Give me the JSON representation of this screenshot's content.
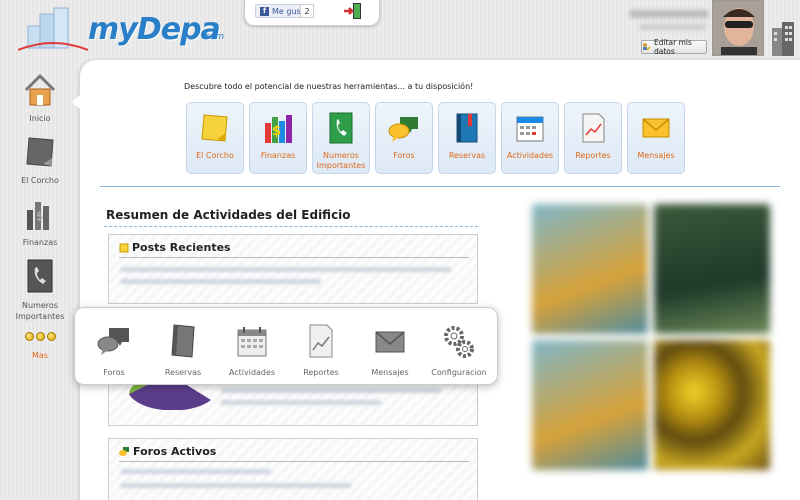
{
  "brand": {
    "logo_text": "myDepa",
    "logo_suffix": ".com"
  },
  "header": {
    "fb_like_label": "Me gusta",
    "fb_like_count": "2",
    "edit_profile_label": "Editar mis datos"
  },
  "left_nav": {
    "items": [
      {
        "label": "Inicio",
        "icon": "house-icon"
      },
      {
        "label": "El Corcho",
        "icon": "note-icon"
      },
      {
        "label": "Finanzas",
        "icon": "money-icon"
      },
      {
        "label": "Numeros Importantes",
        "icon": "phone-icon"
      },
      {
        "label": "Mas",
        "icon": "dots-icon"
      }
    ]
  },
  "main": {
    "tagline": "Descubre todo el potencial de nuestras herramientas... a tu disposición!",
    "tools": [
      {
        "label": "El Corcho",
        "icon": "sticky-note-icon"
      },
      {
        "label": "Finanzas",
        "icon": "finance-icon"
      },
      {
        "label": "Numeros Importantes",
        "icon": "phone-book-icon"
      },
      {
        "label": "Foros",
        "icon": "chat-bubbles-icon"
      },
      {
        "label": "Reservas",
        "icon": "book-icon"
      },
      {
        "label": "Actividades",
        "icon": "calendar-icon"
      },
      {
        "label": "Reportes",
        "icon": "report-icon"
      },
      {
        "label": "Mensajes",
        "icon": "envelope-icon"
      }
    ],
    "section_title": "Resumen de Actividades del Edificio",
    "boxes": [
      {
        "title": "Posts Recientes"
      },
      {
        "title": "Foros Activos"
      }
    ]
  },
  "popup": {
    "items": [
      {
        "label": "Foros",
        "icon": "chat-bubbles-icon"
      },
      {
        "label": "Reservas",
        "icon": "book-icon"
      },
      {
        "label": "Actividades",
        "icon": "calendar-icon"
      },
      {
        "label": "Reportes",
        "icon": "report-icon"
      },
      {
        "label": "Mensajes",
        "icon": "envelope-icon"
      },
      {
        "label": "Configuracion",
        "icon": "gears-icon"
      }
    ]
  },
  "colors": {
    "accent": "#e06a1a",
    "brand": "#2a7fc9",
    "divider": "#8ab5d8"
  }
}
